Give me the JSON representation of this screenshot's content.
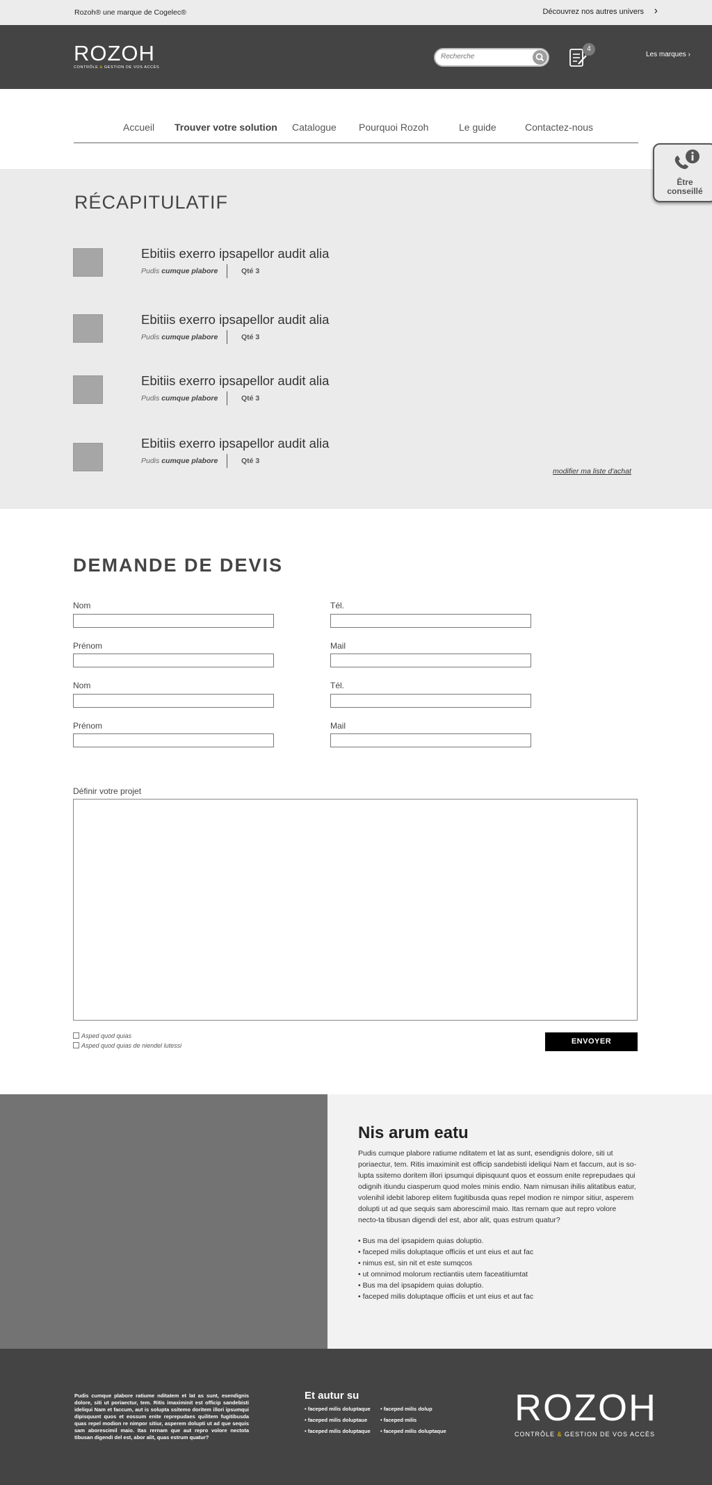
{
  "topbar": {
    "brand_note": "Rozoh® une marque de Cogelec®",
    "univers_link": "Découvrez nos autres univers",
    "univers_chevron": "›"
  },
  "header": {
    "logo_word": "ROZOH",
    "logo_sub_part1": "CONTRÔLE ",
    "logo_amp": "&",
    "logo_sub_part2": " GESTION DE VOS ACCÈS",
    "search_placeholder": "Recherche",
    "cart_count": "4",
    "brands_link": "Les marques ›"
  },
  "nav": {
    "items": [
      {
        "label": "Accueil"
      },
      {
        "label": "Trouver votre solution"
      },
      {
        "label": "Catalogue"
      },
      {
        "label": "Pourquoi Rozoh"
      },
      {
        "label": "Le guide"
      },
      {
        "label": "Contactez-nous"
      }
    ]
  },
  "advice": {
    "label_line1": "Être",
    "label_line2": "conseillé"
  },
  "recap": {
    "title": "RÉCAPITULATIF",
    "items": [
      {
        "name": "Ebitiis exerro ipsapellor audit alia",
        "meta_italic": "Pudis ",
        "meta_bold": "cumque plabore",
        "qty": "Qté  3"
      },
      {
        "name": "Ebitiis exerro ipsapellor audit alia",
        "meta_italic": "Pudis ",
        "meta_bold": "cumque plabore",
        "qty": "Qté  3"
      },
      {
        "name": "Ebitiis exerro ipsapellor audit alia",
        "meta_italic": "Pudis ",
        "meta_bold": "cumque plabore",
        "qty": "Qté  3"
      },
      {
        "name": "Ebitiis exerro ipsapellor audit alia",
        "meta_italic": "Pudis ",
        "meta_bold": "cumque plabore",
        "qty": "Qté  3"
      }
    ],
    "modify_link": "modifier ma liste d'achat"
  },
  "form": {
    "title": "DEMANDE  DE  DEVIS",
    "fields": [
      {
        "label": "Nom"
      },
      {
        "label": "Tél."
      },
      {
        "label": "Prénom"
      },
      {
        "label": "Mail"
      },
      {
        "label": "Nom"
      },
      {
        "label": "Tél."
      },
      {
        "label": "Prénom"
      },
      {
        "label": "Mail"
      }
    ],
    "project_label": "Définir votre projet",
    "checkboxes": [
      {
        "label": "Asped quod quias"
      },
      {
        "label": "Asped quod quias de niendel lutessi"
      }
    ],
    "submit_label": "ENVOYER"
  },
  "info": {
    "title": "Nis arum eatu",
    "text": "Pudis cumque plabore ratiume nditatem et lat as sunt, esendignis dolore, siti ut poriaectur, tem. Ritis imaximinit est officip sandebisti ideliqui Nam et faccum, aut is so-lupta ssitemo doritem illori ipsumqui dipisquunt quos et eossum enite reprepudaes qui odignih itiundu ciasperum quod moles minis endio. Nam nimusan ihilis alitatibus eatur, volenihil idebit laborep elitem fugitibusda quas repel modion re nimpor sitiur, asperem dolupti ut ad que sequis sam aborescimil maio. Itas rernam que aut repro volore necto-ta tibusan digendi del est, abor alit, quas estrum quatur?",
    "list": [
      "• Bus ma del ipsapidem quias doluptio.",
      "• faceped milis doluptaque officiis et unt eius et aut fac",
      "• nimus est, sin nit et este sumqcos",
      "• ut omnimod molorum rectiantiis utem faceatitiumtat",
      "• Bus ma del ipsapidem quias doluptio.",
      "• faceped milis doluptaque officiis et unt eius et aut fac"
    ]
  },
  "footer": {
    "text": "Pudis cumque plabore ratiume nditatem et lat as sunt, esendignis dolore, siti ut poriaectur, tem. Ritis imaximinit est officip sandebisti ideliqui Nam et faccum, aut is solupta ssitemo doritem illori ipsumqui dipisquunt quos et eossum enite reprepudaes quilitem fugitibusda quas repel modion re nimpor sitiur, asperem dolupti ut ad que sequis sam aborescimil maio. Itas rernam que aut repro volore nectota tibusan digendi del est, abor alit, quas estrum quatur?",
    "heading": "Et autur su",
    "links_col1": [
      "• faceped milis doluptaque",
      "• faceped milis doluptaue",
      "• faceped milis doluptaque"
    ],
    "links_col2": [
      "• faceped milis dolup",
      "• faceped milis",
      "• faceped milis doluptaque"
    ],
    "logo_word": "ROZOH",
    "logo_sub_part1": "CONTRÔLE ",
    "logo_amp": "&",
    "logo_sub_part2": " GESTION DE VOS ACCÈS"
  },
  "colors": {
    "header_bg": "#444444",
    "topbar_bg": "#ececec",
    "recap_bg": "#ebebeb",
    "button_bg": "#000000",
    "accent_yellow": "#f0c400"
  },
  "icons": [
    "chevron-right-icon",
    "search-icon",
    "quote-list-icon",
    "phone-info-icon"
  ]
}
